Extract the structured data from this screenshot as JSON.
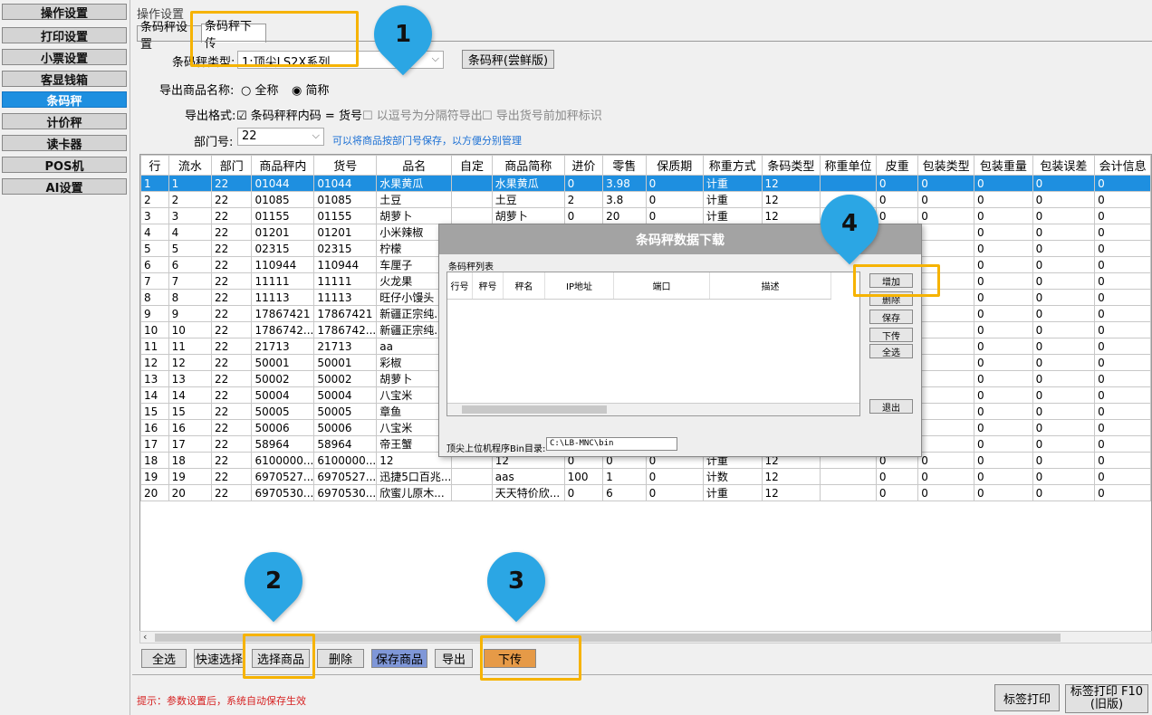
{
  "sidebar": {
    "items": [
      {
        "label": "操作设置",
        "active": false
      },
      {
        "label": "打印设置",
        "active": false
      },
      {
        "label": "小票设置",
        "active": false
      },
      {
        "label": "客显钱箱",
        "active": false
      },
      {
        "label": "条码秤",
        "active": true
      },
      {
        "label": "计价秤",
        "active": false
      },
      {
        "label": "读卡器",
        "active": false
      },
      {
        "label": "POS机",
        "active": false
      },
      {
        "label": "AI设置",
        "active": false
      }
    ]
  },
  "main": {
    "section_title": "操作设置",
    "tabs": [
      "条码秤设置",
      "条码秤下传"
    ],
    "scale_type_label": "条码秤类型:",
    "scale_type_value": "1:顶尖LS2X系列",
    "scale_trial_button": "条码秤(尝鲜版)",
    "export_name_label": "导出商品名称:",
    "export_name_full": "全称",
    "export_name_short": "简称",
    "export_format_label": "导出格式:",
    "export_opt1": "条码秤秤内码 = 货号",
    "export_opt2": "以逗号为分隔符导出",
    "export_opt3": "导出货号前加秤标识",
    "dept_label": "部门号:",
    "dept_value": "22",
    "dept_hint": "可以将商品按部门号保存，以方便分别管理"
  },
  "table": {
    "headers": [
      "行",
      "流水",
      "部门",
      "商品秤内",
      "货号",
      "品名",
      "自定",
      "商品简称",
      "进价",
      "零售",
      "保质期",
      "称重方式",
      "条码类型",
      "称重单位",
      "皮重",
      "包装类型",
      "包装重量",
      "包装误差",
      "会计信息"
    ],
    "rows": [
      [
        "1",
        "1",
        "22",
        "01044",
        "01044",
        "水果黄瓜",
        "",
        "水果黄瓜",
        "0",
        "3.98",
        "0",
        "计重",
        "12",
        "",
        "0",
        "0",
        "0",
        "0",
        "0"
      ],
      [
        "2",
        "2",
        "22",
        "01085",
        "01085",
        "土豆",
        "",
        "土豆",
        "2",
        "3.8",
        "0",
        "计重",
        "12",
        "",
        "0",
        "0",
        "0",
        "0",
        "0"
      ],
      [
        "3",
        "3",
        "22",
        "01155",
        "01155",
        "胡萝卜",
        "",
        "胡萝卜",
        "0",
        "20",
        "0",
        "计重",
        "12",
        "",
        "0",
        "0",
        "0",
        "0",
        "0"
      ],
      [
        "4",
        "4",
        "22",
        "01201",
        "01201",
        "小米辣椒",
        "",
        "",
        "",
        "",
        "",
        "",
        "",
        "",
        "",
        "",
        "0",
        "0",
        "0"
      ],
      [
        "5",
        "5",
        "22",
        "02315",
        "02315",
        "柠檬",
        "",
        "",
        "",
        "",
        "",
        "",
        "",
        "",
        "",
        "",
        "0",
        "0",
        "0"
      ],
      [
        "6",
        "6",
        "22",
        "110944",
        "110944",
        "车厘子",
        "",
        "",
        "",
        "",
        "",
        "",
        "",
        "",
        "",
        "",
        "0",
        "0",
        "0"
      ],
      [
        "7",
        "7",
        "22",
        "11111",
        "11111",
        "火龙果",
        "",
        "",
        "",
        "",
        "",
        "",
        "",
        "",
        "",
        "",
        "0",
        "0",
        "0"
      ],
      [
        "8",
        "8",
        "22",
        "11113",
        "11113",
        "旺仔小馒头",
        "",
        "",
        "",
        "",
        "",
        "",
        "",
        "",
        "",
        "",
        "0",
        "0",
        "0"
      ],
      [
        "9",
        "9",
        "22",
        "17867421",
        "17867421",
        "新疆正宗纯...",
        "",
        "",
        "",
        "",
        "",
        "",
        "",
        "",
        "",
        "",
        "0",
        "0",
        "0"
      ],
      [
        "10",
        "10",
        "22",
        "1786742...",
        "1786742...",
        "新疆正宗纯...",
        "",
        "",
        "",
        "",
        "",
        "",
        "",
        "",
        "",
        "",
        "0",
        "0",
        "0"
      ],
      [
        "11",
        "11",
        "22",
        "21713",
        "21713",
        "aa",
        "",
        "",
        "",
        "",
        "",
        "",
        "",
        "",
        "",
        "",
        "0",
        "0",
        "0"
      ],
      [
        "12",
        "12",
        "22",
        "50001",
        "50001",
        "彩椒",
        "",
        "",
        "",
        "",
        "",
        "",
        "",
        "",
        "",
        "",
        "0",
        "0",
        "0"
      ],
      [
        "13",
        "13",
        "22",
        "50002",
        "50002",
        "胡萝卜",
        "",
        "",
        "",
        "",
        "",
        "",
        "",
        "",
        "",
        "",
        "0",
        "0",
        "0"
      ],
      [
        "14",
        "14",
        "22",
        "50004",
        "50004",
        "八宝米",
        "",
        "",
        "",
        "",
        "",
        "",
        "",
        "",
        "",
        "",
        "0",
        "0",
        "0"
      ],
      [
        "15",
        "15",
        "22",
        "50005",
        "50005",
        "章鱼",
        "",
        "",
        "",
        "",
        "",
        "",
        "",
        "",
        "",
        "",
        "0",
        "0",
        "0"
      ],
      [
        "16",
        "16",
        "22",
        "50006",
        "50006",
        "八宝米",
        "",
        "",
        "",
        "",
        "",
        "",
        "",
        "",
        "",
        "",
        "0",
        "0",
        "0"
      ],
      [
        "17",
        "17",
        "22",
        "58964",
        "58964",
        "帝王蟹",
        "",
        "",
        "",
        "",
        "",
        "",
        "",
        "",
        "",
        "",
        "0",
        "0",
        "0"
      ],
      [
        "18",
        "18",
        "22",
        "6100000...",
        "6100000...",
        "12",
        "",
        "12",
        "0",
        "0",
        "0",
        "计重",
        "12",
        "",
        "0",
        "0",
        "0",
        "0",
        "0"
      ],
      [
        "19",
        "19",
        "22",
        "6970527...",
        "6970527...",
        "迅捷5口百兆...",
        "",
        "aas",
        "100",
        "1",
        "0",
        "计数",
        "12",
        "",
        "0",
        "0",
        "0",
        "0",
        "0"
      ],
      [
        "20",
        "20",
        "22",
        "6970530...",
        "6970530...",
        "欣蜜儿原木...",
        "",
        "天天特价欣...",
        "0",
        "6",
        "0",
        "计重",
        "12",
        "",
        "0",
        "0",
        "0",
        "0",
        "0"
      ]
    ]
  },
  "bottom_buttons": [
    "全选",
    "快速选择",
    "选择商品",
    "删除",
    "保存商品",
    "导出",
    "下传"
  ],
  "bottom_tip": "提示：参数设置后，系统自动保存生效",
  "label_print_button": "标签打印",
  "label_print_old_button": "标签打印 F10 (旧版)",
  "dialog": {
    "title": "条码秤数据下载",
    "group_label": "条码秤列表",
    "headers": [
      "行号",
      "秤号",
      "秤名",
      "IP地址",
      "端口",
      "描述"
    ],
    "buttons": [
      "增加",
      "删除",
      "保存",
      "下传",
      "全选"
    ],
    "exit_button": "退出",
    "bin_label": "顶尖上位机程序Bin目录:",
    "bin_value": "C:\\LB-MNC\\bin"
  },
  "callouts": [
    "1",
    "2",
    "3",
    "4"
  ],
  "colors": {
    "accent": "#1e8fe0",
    "highlight": "#f6b300",
    "pin": "#2ba6e4",
    "tip": "#d62020"
  }
}
